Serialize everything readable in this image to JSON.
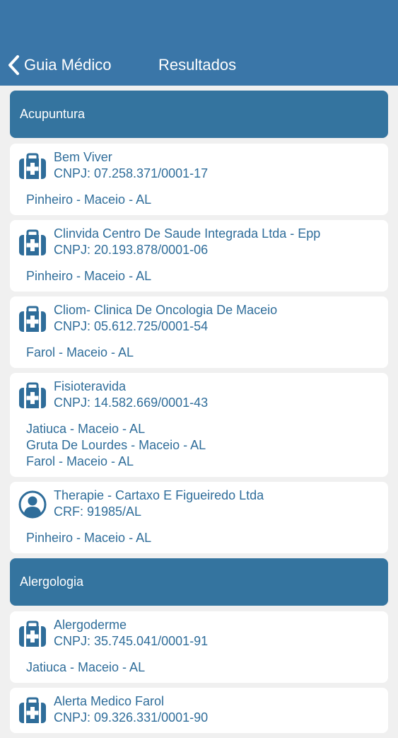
{
  "nav": {
    "back_label": "Guia Médico",
    "title": "Resultados"
  },
  "sections": [
    {
      "title": "Acupuntura",
      "items": [
        {
          "icon": "medical-kit-icon",
          "name": "Bem Viver",
          "doc": "CNPJ: 07.258.371/0001-17",
          "locations": [
            "Pinheiro - Maceio - AL"
          ]
        },
        {
          "icon": "medical-kit-icon",
          "name": "Clinvida Centro De Saude Integrada Ltda - Epp",
          "doc": "CNPJ: 20.193.878/0001-06",
          "locations": [
            "Pinheiro  - Maceio - AL"
          ]
        },
        {
          "icon": "medical-kit-icon",
          "name": "Cliom- Clinica De Oncologia De Maceio",
          "doc": "CNPJ: 05.612.725/0001-54",
          "locations": [
            "Farol - Maceio - AL"
          ]
        },
        {
          "icon": "medical-kit-icon",
          "name": "Fisioteravida",
          "doc": "CNPJ: 14.582.669/0001-43",
          "locations": [
            "Jatiuca - Maceio - AL",
            "Gruta De Lourdes - Maceio - AL",
            "Farol - Maceio - AL"
          ]
        },
        {
          "icon": "person-icon",
          "name": "Therapie - Cartaxo E Figueiredo Ltda",
          "doc": "CRF: 91985/AL",
          "locations": [
            "Pinheiro - Maceio - AL"
          ]
        }
      ]
    },
    {
      "title": "Alergologia",
      "items": [
        {
          "icon": "medical-kit-icon",
          "name": "Alergoderme",
          "doc": "CNPJ: 35.745.041/0001-91",
          "locations": [
            "Jatiuca - Maceio - AL"
          ]
        },
        {
          "icon": "medical-kit-icon",
          "name": "Alerta Medico Farol",
          "doc": "CNPJ: 09.326.331/0001-90",
          "locations": []
        }
      ]
    }
  ]
}
